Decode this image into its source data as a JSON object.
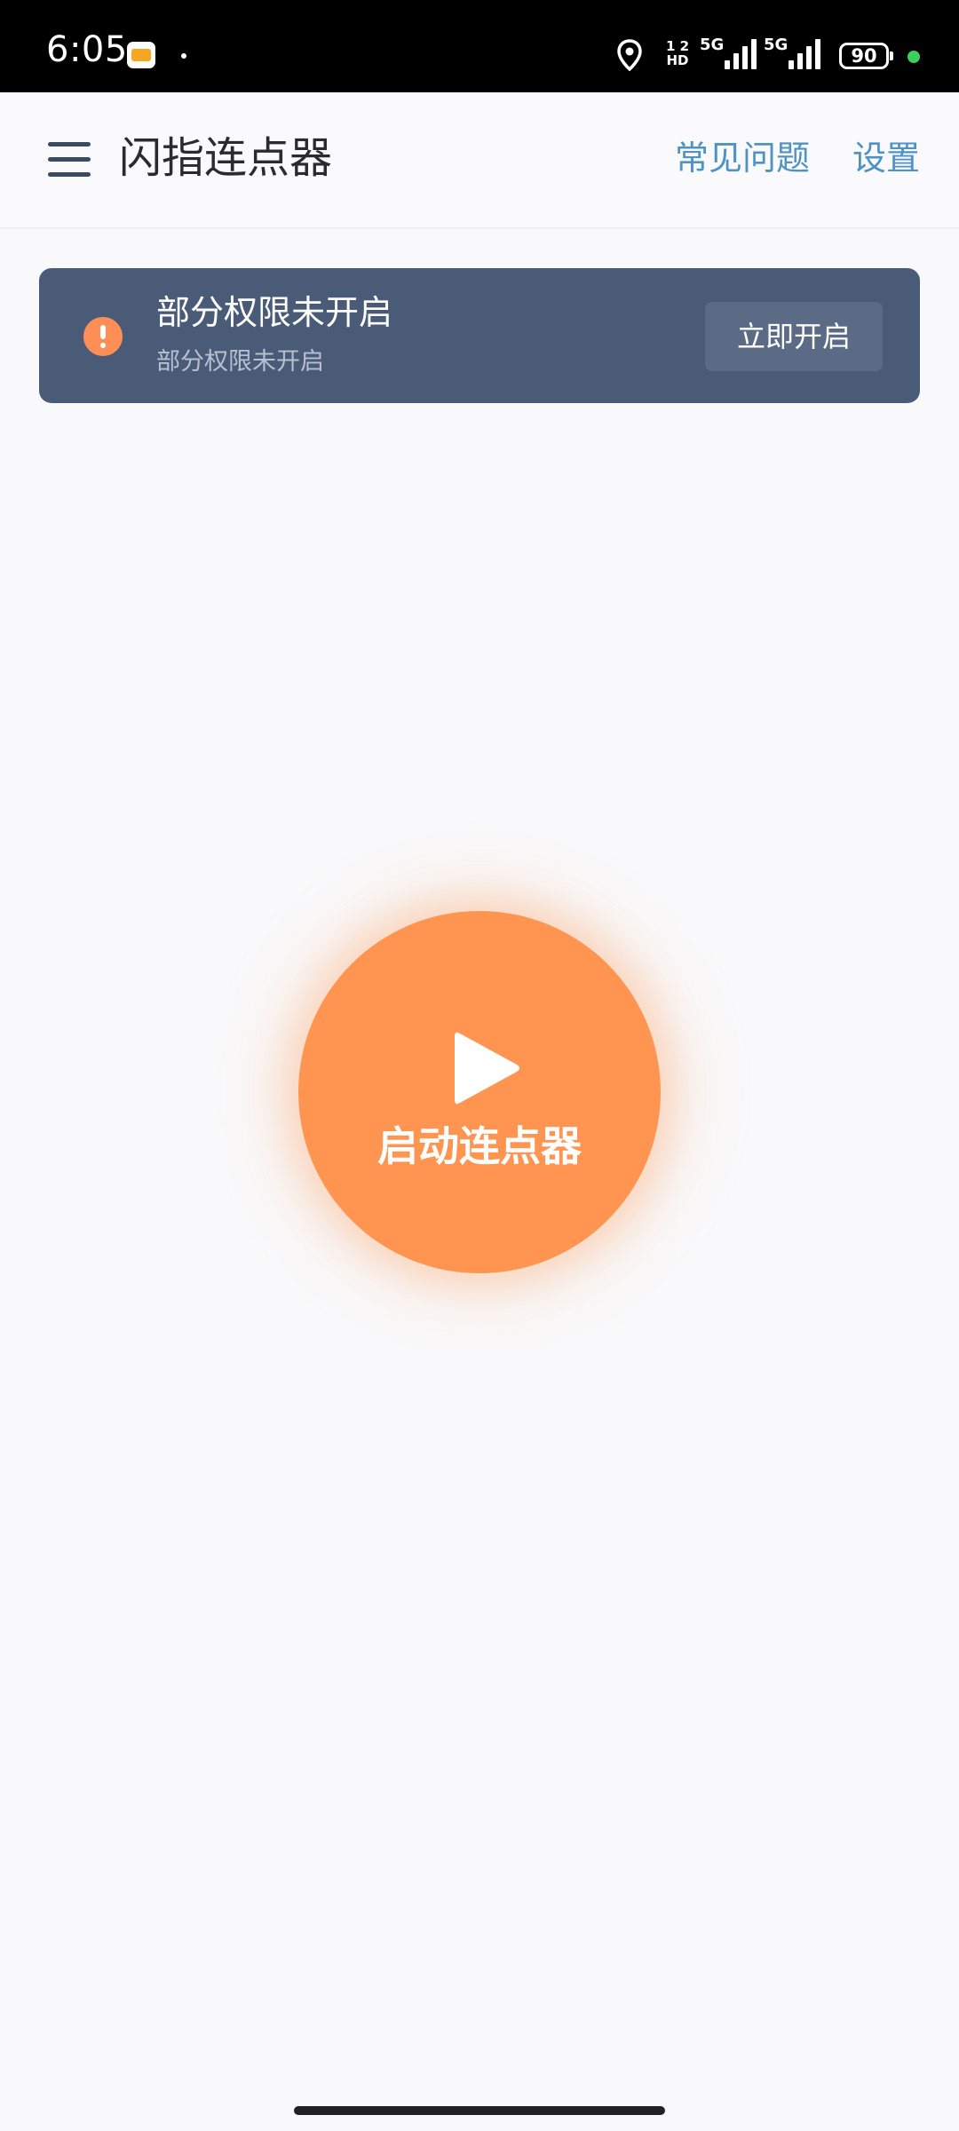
{
  "status_bar": {
    "time": "6:05",
    "hd_top": "1 2",
    "hd_bottom": "HD",
    "sim1_label": "5G",
    "sim2_label": "5G",
    "battery": "90"
  },
  "app_bar": {
    "title": "闪指连点器",
    "faq": "常见问题",
    "settings": "设置"
  },
  "banner": {
    "title": "部分权限未开启",
    "subtitle": "部分权限未开启",
    "button": "立即开启"
  },
  "main": {
    "start_label": "启动连点器"
  },
  "colors": {
    "accent": "#ff9550",
    "banner_bg": "#4a5b78",
    "link": "#4f93c4"
  }
}
